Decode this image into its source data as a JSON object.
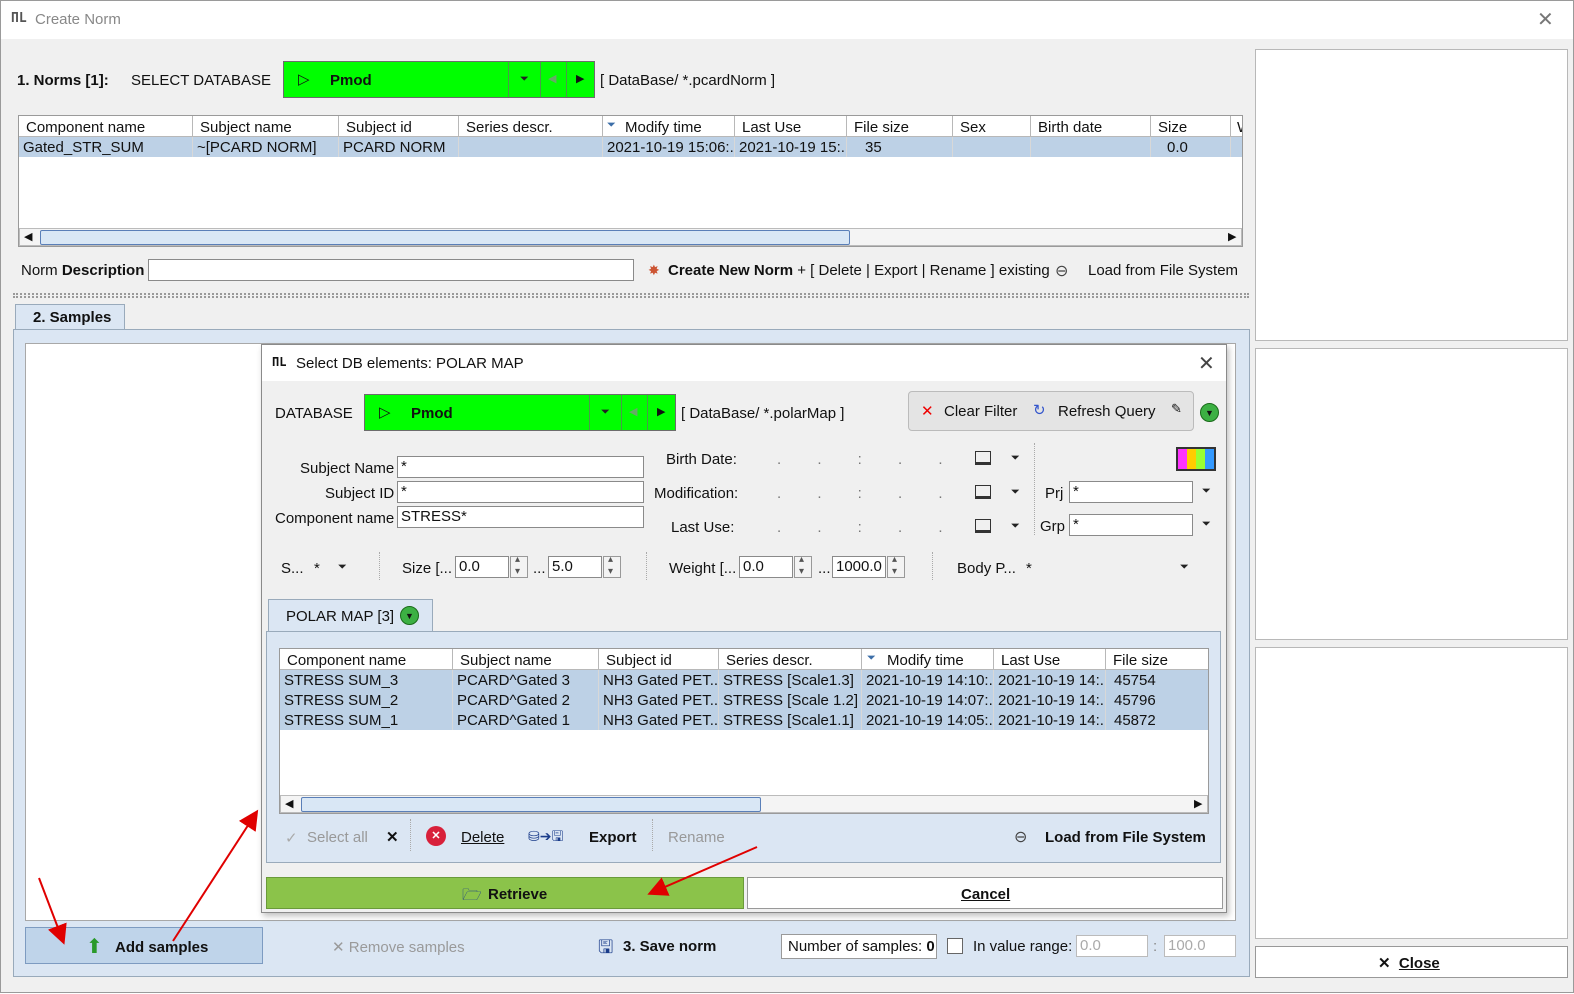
{
  "window": {
    "title": "Create Norm",
    "app_icon": "pmod-logo-icon"
  },
  "norms": {
    "section_label": "1. Norms [1]:",
    "select_db_label": "SELECT DATABASE",
    "db_name": "Pmod",
    "db_path": "[  DataBase/ *.pcardNorm  ]",
    "columns": [
      "Component name",
      "Subject name",
      "Subject id",
      "Series descr.",
      "Modify time",
      "Last Use",
      "File size",
      "Sex",
      "Birth date",
      "Size",
      "W"
    ],
    "rows": [
      [
        "Gated_STR_SUM",
        "~[PCARD NORM]",
        "PCARD NORM",
        "",
        "2021-10-19 15:06:...",
        "2021-10-19 15:...",
        "35",
        "",
        "",
        "0.0",
        ""
      ]
    ],
    "norm_description_prefix": "Norm ",
    "norm_description_bold": "Description",
    "norm_description_value": "",
    "create_new": "Create New Norm",
    "create_rest": "+ [ Delete | Export | Rename ] existing",
    "load_fs": "Load from File System"
  },
  "samples": {
    "tab_label": "2. Samples",
    "add_samples": "Add samples",
    "remove_samples": "Remove samples",
    "save_norm": "3. Save norm",
    "num_samples_label": "Number of samples:",
    "num_samples_value": "0",
    "in_value_range": "In value range:",
    "range_min": "0.0",
    "range_max": "100.0",
    "range_sep": ":"
  },
  "close_label": "Close",
  "dialog": {
    "title": "Select DB elements: POLAR MAP",
    "db_label": "DATABASE",
    "db_name": "Pmod",
    "db_path": "[  DataBase/ *.polarMap  ]",
    "clear_filter": "Clear Filter",
    "refresh_query": "Refresh Query",
    "subject_name_label": "Subject Name",
    "subject_name_value": "*",
    "subject_id_label": "Subject ID",
    "subject_id_value": "*",
    "component_name_label": "Component name",
    "component_name_value": "STRESS*",
    "birth_date_label": "Birth Date:",
    "modification_label": "Modification:",
    "last_use_label": "Last Use:",
    "date_placeholder": ".   .   :   .   .",
    "prj_label": "Prj",
    "prj_value": "*",
    "grp_label": "Grp",
    "grp_value": "*",
    "s_label": "S...",
    "s_value": "*",
    "size_label": "Size [...",
    "size_min": "0.0",
    "size_max": "5.0",
    "weight_label": "Weight [...",
    "weight_min": "0.0",
    "weight_max": "1000.0",
    "range_dots": "...",
    "body_label": "Body P...",
    "body_value": "*",
    "tab_label": "POLAR MAP [3]",
    "columns": [
      "Component name",
      "Subject name",
      "Subject id",
      "Series descr.",
      "Modify time",
      "Last Use",
      "File size"
    ],
    "rows": [
      [
        "STRESS SUM_3",
        "PCARD^Gated 3",
        "NH3 Gated PET...",
        "STRESS [Scale1.3]",
        "2021-10-19 14:10:...",
        "2021-10-19 14:...",
        "45754"
      ],
      [
        "STRESS SUM_2",
        "PCARD^Gated 2",
        "NH3 Gated PET...",
        "STRESS [Scale 1.2]",
        "2021-10-19 14:07:...",
        "2021-10-19 14:...",
        "45796"
      ],
      [
        "STRESS SUM_1",
        "PCARD^Gated 1",
        "NH3 Gated PET...",
        "STRESS [Scale1.1]",
        "2021-10-19 14:05:...",
        "2021-10-19 14:...",
        "45872"
      ]
    ],
    "select_all": "Select all",
    "delete": "Delete",
    "export": "Export",
    "rename": "Rename",
    "load_fs": "Load from File System",
    "retrieve": "Retrieve",
    "cancel": "Cancel"
  },
  "colors": {
    "db_green": "#00ff00",
    "retrieve_green": "#8bc34a",
    "selected_row": "#bdd1e6",
    "annotation_red": "#e00000"
  }
}
